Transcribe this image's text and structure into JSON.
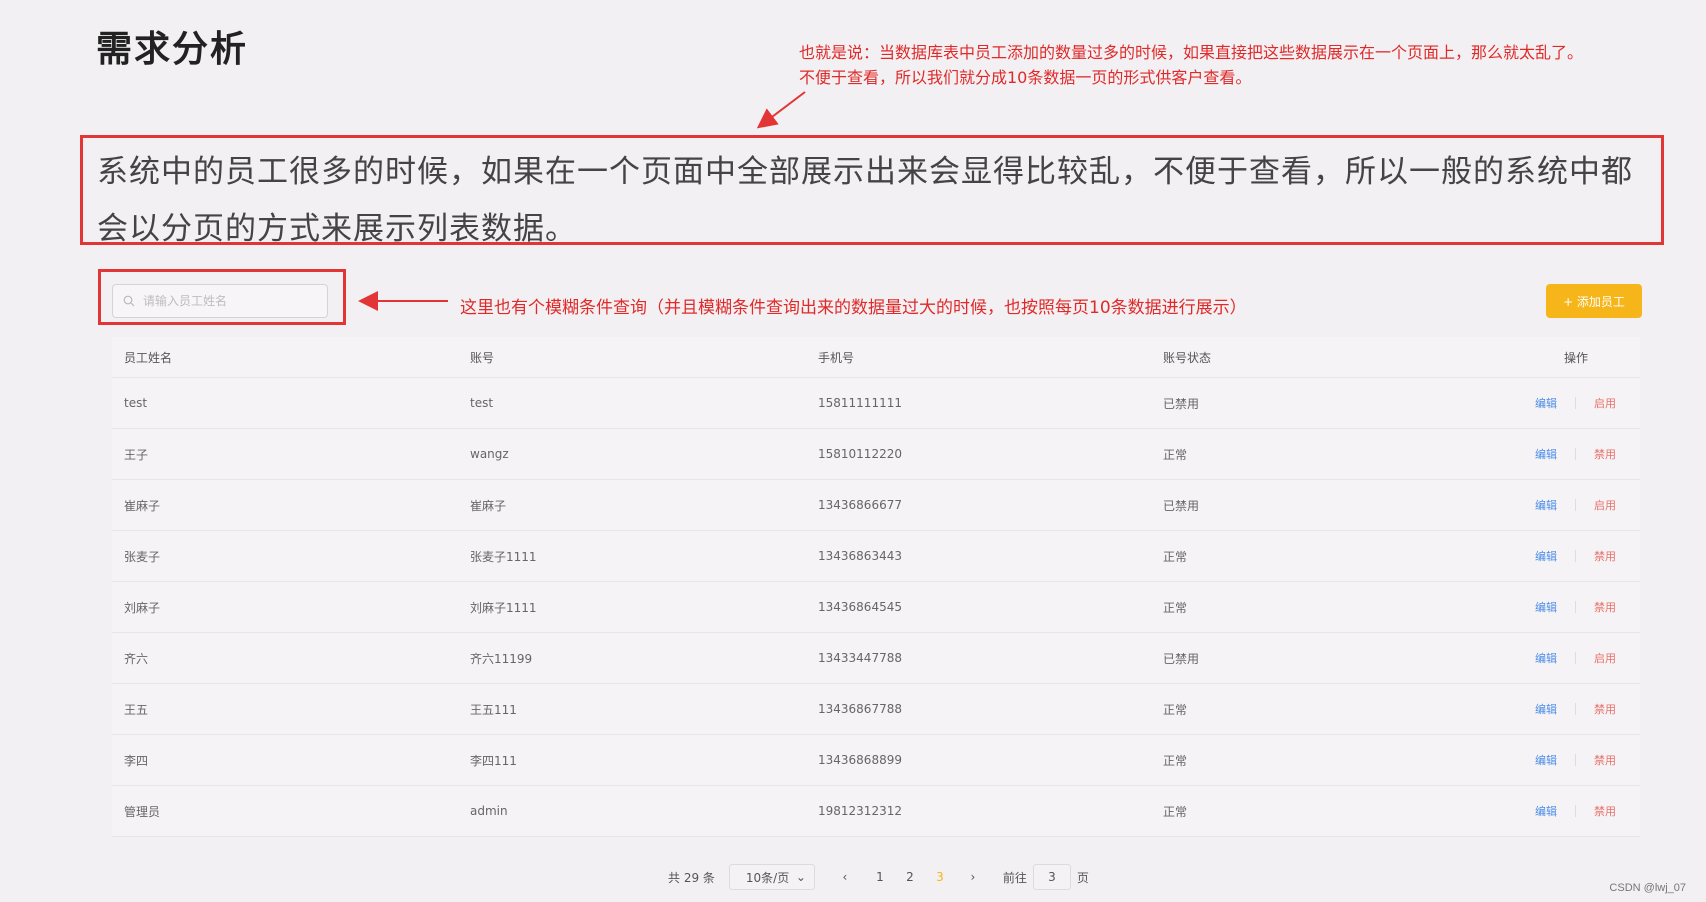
{
  "heading": "需求分析",
  "annotation_top": {
    "line1": "也就是说：当数据库表中员工添加的数量过多的时候，如果直接把这些数据展示在一个页面上，那么就太乱了。",
    "line2": "不便于查看，所以我们就分成10条数据一页的形式供客户查看。"
  },
  "intro": "系统中的员工很多的时候，如果在一个页面中全部展示出来会显得比较乱，不便于查看，所以一般的系统中都会以分页的方式来展示列表数据。",
  "search": {
    "placeholder": "请输入员工姓名",
    "icon": "search-icon"
  },
  "annotation_mid": "这里也有个模糊条件查询（并且模糊条件查询出来的数据量过大的时候，也按照每页10条数据进行展示）",
  "add_button": "+ 添加员工",
  "table": {
    "headers": [
      "员工姓名",
      "账号",
      "手机号",
      "账号状态",
      "操作"
    ],
    "rows": [
      {
        "name": "test",
        "account": "test",
        "phone": "15811111111",
        "status": "已禁用",
        "edit": "编辑",
        "toggle": "启用"
      },
      {
        "name": "王子",
        "account": "wangz",
        "phone": "15810112220",
        "status": "正常",
        "edit": "编辑",
        "toggle": "禁用"
      },
      {
        "name": "崔麻子",
        "account": "崔麻子",
        "phone": "13436866677",
        "status": "已禁用",
        "edit": "编辑",
        "toggle": "启用"
      },
      {
        "name": "张麦子",
        "account": "张麦子1111",
        "phone": "13436863443",
        "status": "正常",
        "edit": "编辑",
        "toggle": "禁用"
      },
      {
        "name": "刘麻子",
        "account": "刘麻子1111",
        "phone": "13436864545",
        "status": "正常",
        "edit": "编辑",
        "toggle": "禁用"
      },
      {
        "name": "齐六",
        "account": "齐六11199",
        "phone": "13433447788",
        "status": "已禁用",
        "edit": "编辑",
        "toggle": "启用"
      },
      {
        "name": "王五",
        "account": "王五111",
        "phone": "13436867788",
        "status": "正常",
        "edit": "编辑",
        "toggle": "禁用"
      },
      {
        "name": "李四",
        "account": "李四111",
        "phone": "13436868899",
        "status": "正常",
        "edit": "编辑",
        "toggle": "禁用"
      },
      {
        "name": "管理员",
        "account": "admin",
        "phone": "19812312312",
        "status": "正常",
        "edit": "编辑",
        "toggle": "禁用"
      }
    ]
  },
  "pagination": {
    "total": "共 29 条",
    "page_size": "10条/页",
    "pages": [
      "1",
      "2",
      "3"
    ],
    "current_page": "3",
    "goto_label": "前往",
    "goto_value": "3",
    "page_unit": "页"
  },
  "watermark": "CSDN @lwj_07",
  "colors": {
    "accent": "#f6b518",
    "annotation": "#e02a2a",
    "link": "#4a8ce8",
    "danger": "#e8726b"
  }
}
